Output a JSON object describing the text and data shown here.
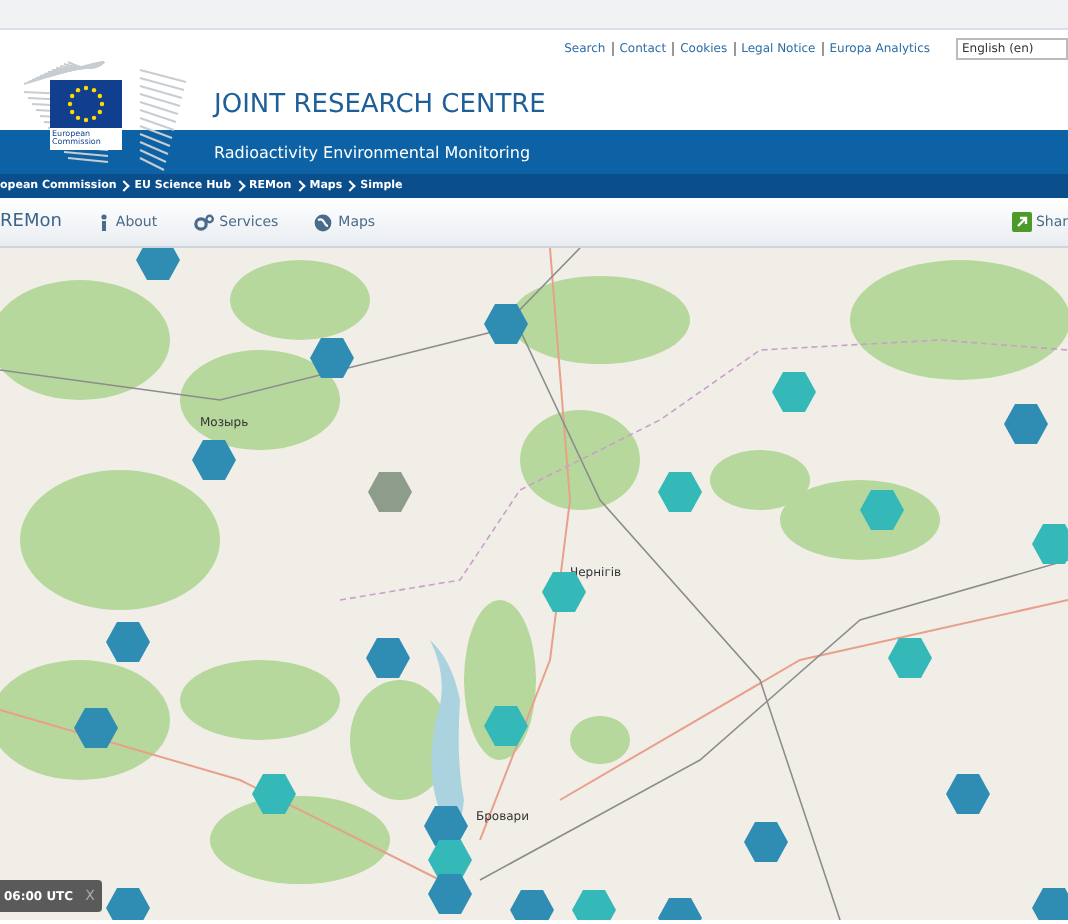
{
  "top_links": [
    "Search",
    "Contact",
    "Cookies",
    "Legal Notice",
    "Europa Analytics"
  ],
  "language": {
    "value": "English (en)"
  },
  "logo": {
    "caption": "European Commission"
  },
  "site_title": "JOINT RESEARCH CENTRE",
  "site_subtitle": "Radioactivity Environmental Monitoring",
  "breadcrumb": [
    "opean Commission",
    "EU Science Hub",
    "REMon",
    "Maps",
    "Simple"
  ],
  "nav": {
    "brand": "REMon",
    "items": [
      {
        "label": "About",
        "kind": "info"
      },
      {
        "label": "Services",
        "kind": "gears"
      },
      {
        "label": "Maps",
        "kind": "globe"
      }
    ],
    "share": "Shar"
  },
  "map": {
    "place_labels": [
      "Мозырь",
      "Чернігів",
      "Бровари"
    ],
    "markers": [
      {
        "color": "#2f8db3"
      },
      {
        "color": "#2f8db3"
      },
      {
        "color": "#2f8db3"
      },
      {
        "color": "#2f8db3"
      },
      {
        "color": "#8e9c8c"
      },
      {
        "color": "#35b8b8"
      },
      {
        "color": "#35b8b8"
      },
      {
        "color": "#35b8b8"
      },
      {
        "color": "#2f8db3"
      },
      {
        "color": "#35b8b8"
      },
      {
        "color": "#35b8b8"
      },
      {
        "color": "#2f8db3"
      },
      {
        "color": "#2f8db3"
      },
      {
        "color": "#35b8b8"
      },
      {
        "color": "#2f8db3"
      },
      {
        "color": "#35b8b8"
      },
      {
        "color": "#35b8b8"
      },
      {
        "color": "#2f8db3"
      },
      {
        "color": "#2f8db3"
      },
      {
        "color": "#2f8db3"
      },
      {
        "color": "#35b8b8"
      },
      {
        "color": "#2f8db3"
      },
      {
        "color": "#2f8db3"
      },
      {
        "color": "#2f8db3"
      },
      {
        "color": "#35b8b8"
      },
      {
        "color": "#2f8db3"
      },
      {
        "color": "#2f8db3"
      }
    ],
    "time_box": {
      "time": "06:00 UTC",
      "close": "X"
    }
  }
}
